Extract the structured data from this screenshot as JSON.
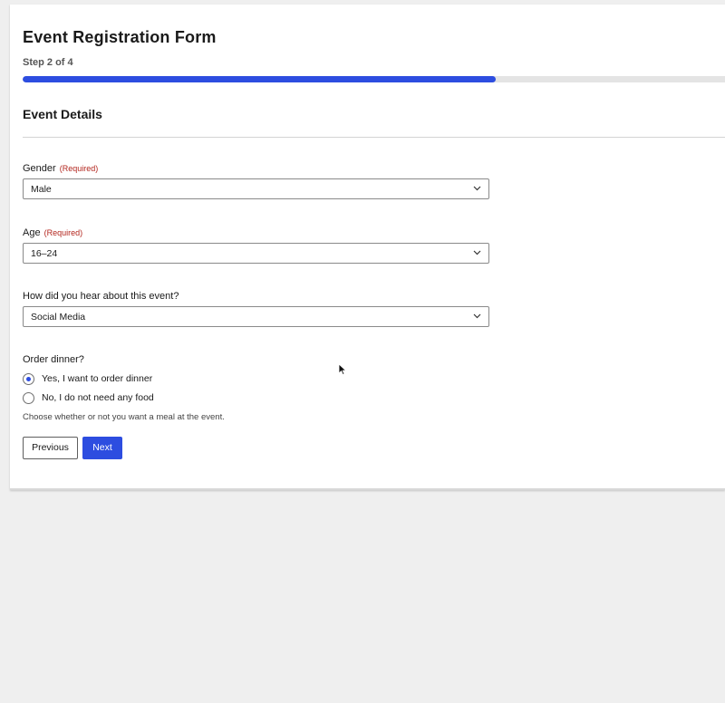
{
  "form": {
    "title": "Event Registration Form",
    "step_text": "Step 2 of 4",
    "progress_fraction": 0.673,
    "section_title": "Event Details"
  },
  "fields": {
    "gender": {
      "label": "Gender",
      "required_text": "(Required)",
      "value": "Male"
    },
    "age": {
      "label": "Age",
      "required_text": "(Required)",
      "value": "16–24"
    },
    "source": {
      "label": "How did you hear about this event?",
      "value": "Social Media"
    }
  },
  "dinner": {
    "label": "Order dinner?",
    "options": [
      {
        "label": "Yes, I want to order dinner",
        "selected": true
      },
      {
        "label": "No, I do not need any food",
        "selected": false
      }
    ],
    "hint": "Choose whether or not you want a meal at the event."
  },
  "buttons": {
    "previous": "Previous",
    "next": "Next"
  },
  "colors": {
    "accent": "#2d4de0",
    "required": "#b3261e",
    "page_background": "#efefef"
  },
  "icons": {
    "select_chevron": "chevron-down-icon",
    "pointer": "mouse-cursor-icon"
  }
}
